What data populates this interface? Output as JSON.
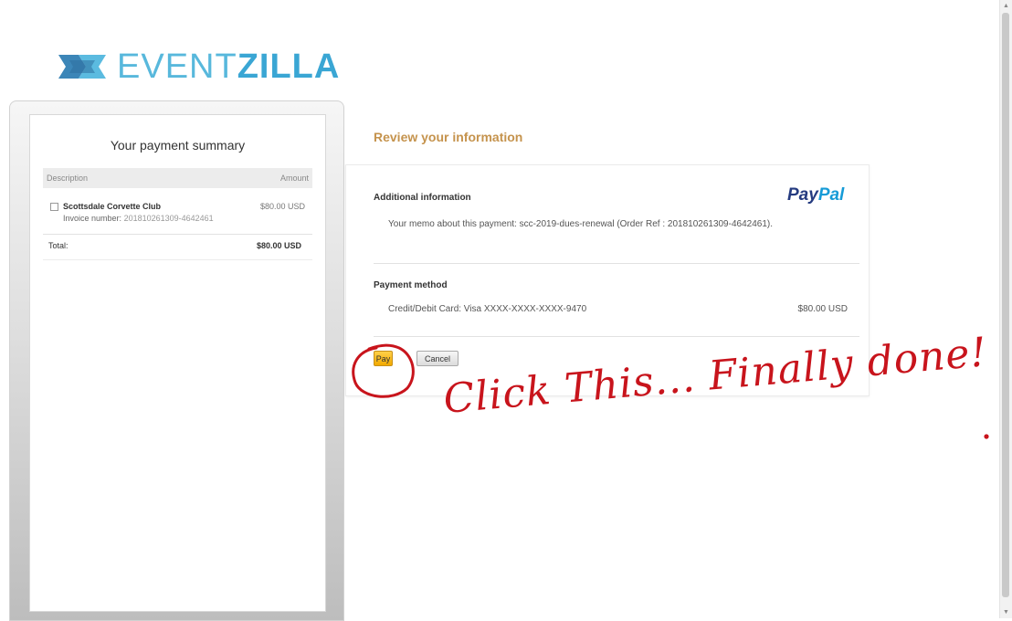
{
  "brand": {
    "logo_light": "EVENT",
    "logo_bold": "ZILLA",
    "colors": {
      "logo_light": "#58b8dc",
      "logo_bold": "#3aa6d4",
      "review_title": "#c5934d",
      "pay_button": "#f5b400",
      "annotation": "#c8141c"
    }
  },
  "summary": {
    "title": "Your payment summary",
    "col_description": "Description",
    "col_amount": "Amount",
    "item": {
      "name": "Scottsdale Corvette Club",
      "amount": "$80.00 USD",
      "invoice_label": "Invoice number:",
      "invoice_number": "201810261309-4642461"
    },
    "total_label": "Total:",
    "total_amount": "$80.00 USD"
  },
  "review": {
    "title": "Review your information",
    "paypal_pay": "Pay",
    "paypal_pal": "Pal",
    "additional_title": "Additional information",
    "memo": "Your memo about this payment: scc-2019-dues-renewal (Order Ref : 201810261309-4642461).",
    "payment_method_title": "Payment method",
    "method_text": "Credit/Debit Card: Visa XXXX-XXXX-XXXX-9470",
    "method_amount": "$80.00 USD",
    "pay_button": "Pay",
    "cancel_button": "Cancel"
  },
  "annotation": {
    "text": "Click This... Finally done!",
    "circle_target": "pay-button"
  },
  "scrollbar": {
    "up_icon": "triangle-up-icon",
    "down_icon": "triangle-down-icon"
  }
}
